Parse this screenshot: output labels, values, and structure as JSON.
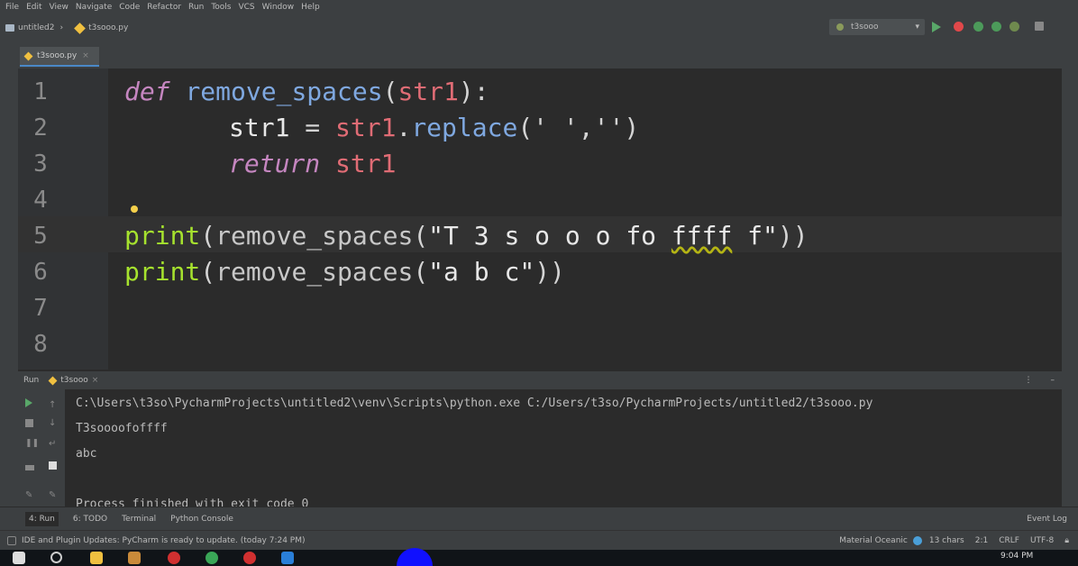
{
  "menu": [
    "File",
    "Edit",
    "View",
    "Navigate",
    "Code",
    "Refactor",
    "Run",
    "Tools",
    "VCS",
    "Window",
    "Help"
  ],
  "breadcrumb": {
    "project": "untitled2",
    "file": "t3sooo.py"
  },
  "run_config": "t3sooo",
  "editor_tab": "t3sooo.py",
  "code_lines": [
    {
      "num": "1"
    },
    {
      "num": "2"
    },
    {
      "num": "3"
    },
    {
      "num": "4"
    },
    {
      "num": "5"
    },
    {
      "num": "6"
    },
    {
      "num": "7"
    },
    {
      "num": "8"
    }
  ],
  "code": {
    "l1": {
      "kw": "def",
      "fn": "remove_spaces",
      "open": "(",
      "arg": "str1",
      "close": "):"
    },
    "l2": {
      "lhs": "str1",
      "eq": " = ",
      "obj": "str1",
      "dot": ".",
      "method": "replace",
      "args": "(' ','')"
    },
    "l3": {
      "kw": "return",
      "val": "str1"
    },
    "l5": {
      "builtin": "print",
      "open": "(",
      "fn": "remove_spaces",
      "open2": "(",
      "s1": "\"T 3 s o o o fo ",
      "sq": "ffff",
      "s2": " f\"",
      "close": "))"
    },
    "l6": {
      "builtin": "print",
      "open": "(",
      "fn": "remove_spaces",
      "open2": "(",
      "s": "\"a b c\"",
      "close": "))"
    }
  },
  "run_panel": {
    "label": "Run",
    "tab": "t3sooo"
  },
  "console": [
    "C:\\Users\\t3so\\PycharmProjects\\untitled2\\venv\\Scripts\\python.exe C:/Users/t3so/PycharmProjects/untitled2/t3sooo.py",
    "T3soooofoffff",
    "abc",
    "",
    "Process finished with exit code 0"
  ],
  "tool_tabs": [
    "4: Run",
    "6: TODO",
    "Terminal",
    "Python Console"
  ],
  "event_log": "Event Log",
  "status": {
    "message": "IDE and Plugin Updates: PyCharm is ready to update. (today 7:24 PM)",
    "interpreter": "Material Oceanic",
    "chars": "13 chars",
    "pos": "2:1",
    "line_sep": "CRLF",
    "encoding": "UTF-8"
  },
  "clock": "9:04 PM",
  "colors": {
    "accent": "#4a88c7",
    "keyword": "#c586c0",
    "function": "#7fa8e0",
    "builtin": "#a6e22e",
    "string": "#6a9955"
  }
}
